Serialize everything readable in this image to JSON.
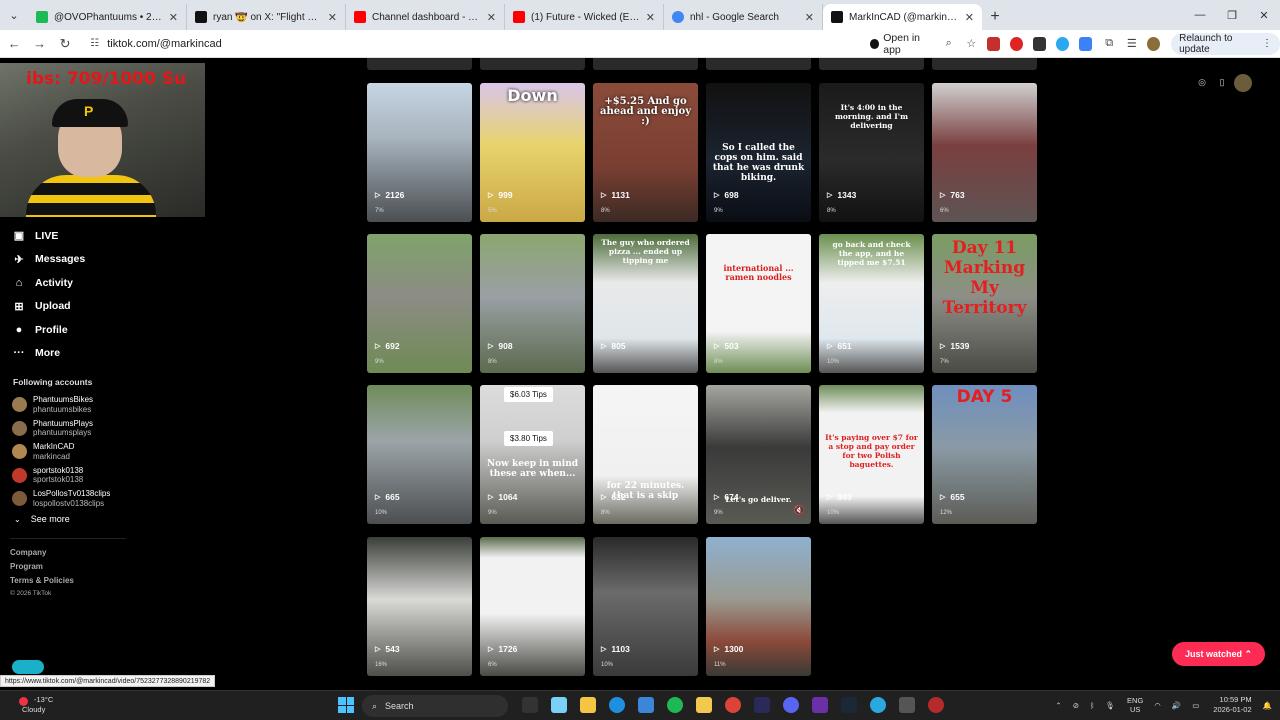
{
  "browser": {
    "tabs": [
      {
        "title": "@OVOPhantuums • 2025 KICK",
        "color": "#1db954"
      },
      {
        "title": "ryan 🤠 on X: \"Flight Reacts is a",
        "color": "#111111"
      },
      {
        "title": "Channel dashboard - YouTube",
        "color": "#ff0000"
      },
      {
        "title": "(1) Future - Wicked (Ear Rape)",
        "color": "#ff0000"
      },
      {
        "title": "nhl - Google Search",
        "color": "#4285f4"
      },
      {
        "title": "MarkInCAD (@markincad) | Tik",
        "color": "#111111",
        "active": true
      }
    ],
    "url": "tiktok.com/@markincad",
    "open_in_app": "Open in app",
    "relaunch": "Relaunch to update"
  },
  "stream_overlay": "ibs: 709/1000  Su",
  "sidebar": {
    "nav": [
      {
        "label": "LIVE",
        "icon": "live-icon"
      },
      {
        "label": "Messages",
        "icon": "messages-icon"
      },
      {
        "label": "Activity",
        "icon": "activity-icon"
      },
      {
        "label": "Upload",
        "icon": "upload-icon"
      },
      {
        "label": "Profile",
        "icon": "profile-icon"
      },
      {
        "label": "More",
        "icon": "more-icon"
      }
    ],
    "following_title": "Following accounts",
    "following": [
      {
        "name": "PhantuumsBikes",
        "handle": "phantuumsbikes"
      },
      {
        "name": "PhantuumsPlays",
        "handle": "phantuumsplays"
      },
      {
        "name": "MarkInCAD",
        "handle": "markincad"
      },
      {
        "name": "sportstok0138",
        "handle": "sportstok0138"
      },
      {
        "name": "LosPollosTv0138clips",
        "handle": "lospollostv0138clips"
      }
    ],
    "see_more": "See more",
    "footer": [
      "Company",
      "Program",
      "Terms & Policies"
    ],
    "copyright": "© 2026 TikTok"
  },
  "videos": [
    {
      "views": "2126",
      "pct": "7%",
      "overlay": ""
    },
    {
      "views": "999",
      "pct": "5%",
      "overlay": "Down"
    },
    {
      "views": "1131",
      "pct": "8%",
      "overlay": "+$5.25 And go ahead and enjoy :)"
    },
    {
      "views": "698",
      "pct": "9%",
      "overlay": "So I called the cops on him. said that he was drunk biking."
    },
    {
      "views": "1343",
      "pct": "8%",
      "overlay": "It's 4:00 in the morning. and I'm delivering"
    },
    {
      "views": "763",
      "pct": "6%",
      "overlay": ""
    },
    {
      "views": "692",
      "pct": "9%",
      "overlay": ""
    },
    {
      "views": "908",
      "pct": "8%",
      "overlay": ""
    },
    {
      "views": "805",
      "pct": "",
      "overlay": "The guy who ordered pizza ... ended up tipping me"
    },
    {
      "views": "503",
      "pct": "8%",
      "overlay": "international ... ramen noodles"
    },
    {
      "views": "651",
      "pct": "10%",
      "overlay": "go back and check the app, and he tipped me $7.51"
    },
    {
      "views": "1539",
      "pct": "7%",
      "overlay": "Day 11 Marking My Territory"
    },
    {
      "views": "665",
      "pct": "10%",
      "overlay": ""
    },
    {
      "views": "1064",
      "pct": "9%",
      "overlay": "Now keep in mind these are when..."
    },
    {
      "views": "632",
      "pct": "8%",
      "overlay": "for 22 minutes. that is a skip"
    },
    {
      "views": "674",
      "pct": "9%",
      "overlay": "Let's go deliver."
    },
    {
      "views": "849",
      "pct": "10%",
      "overlay": "It's paying over $7 for a stop and pay order for two Polish baguettes."
    },
    {
      "views": "655",
      "pct": "12%",
      "overlay": "DAY 5"
    },
    {
      "views": "543",
      "pct": "16%",
      "overlay": ""
    },
    {
      "views": "1726",
      "pct": "6%",
      "overlay": ""
    },
    {
      "views": "1103",
      "pct": "10%",
      "overlay": ""
    },
    {
      "views": "1300",
      "pct": "11%",
      "overlay": ""
    }
  ],
  "tip_chips": {
    "a": "$6.03 Tips",
    "b": "$3.80 Tips"
  },
  "just_watched": "Just watched",
  "status_url": "https://www.tiktok.com/@markincad/video/7523277328890219782",
  "taskbar": {
    "temp": "-13°C",
    "weather": "Cloudy",
    "search": "Search",
    "lang": "ENG",
    "region": "US",
    "time": "10:59 PM",
    "date": "2026-01-02"
  }
}
